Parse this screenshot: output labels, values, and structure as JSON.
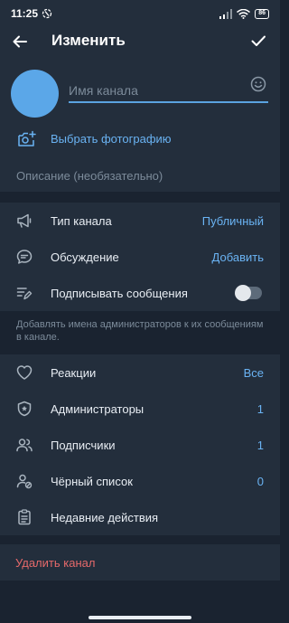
{
  "status_bar": {
    "time": "11:25",
    "battery": "86"
  },
  "app_bar": {
    "title": "Изменить"
  },
  "channel": {
    "name_placeholder": "Имя канала",
    "choose_photo": "Выбрать фотографию",
    "description_placeholder": "Описание (необязательно)"
  },
  "settings": {
    "channel_type": {
      "label": "Тип канала",
      "value": "Публичный"
    },
    "discussion": {
      "label": "Обсуждение",
      "value": "Добавить"
    },
    "sign_messages": {
      "label": "Подписывать сообщения",
      "enabled": false
    },
    "hint": "Добавлять имена администраторов к их сообщениям в канале."
  },
  "management": {
    "reactions": {
      "label": "Реакции",
      "value": "Все"
    },
    "admins": {
      "label": "Администраторы",
      "value": "1"
    },
    "subscribers": {
      "label": "Подписчики",
      "value": "1"
    },
    "blacklist": {
      "label": "Чёрный список",
      "value": "0"
    },
    "recent_actions": {
      "label": "Недавние действия"
    }
  },
  "delete_channel": "Удалить канал",
  "colors": {
    "accent": "#6ab3f3",
    "danger": "#e5696a",
    "background": "#1a2330",
    "surface": "#232e3c"
  }
}
